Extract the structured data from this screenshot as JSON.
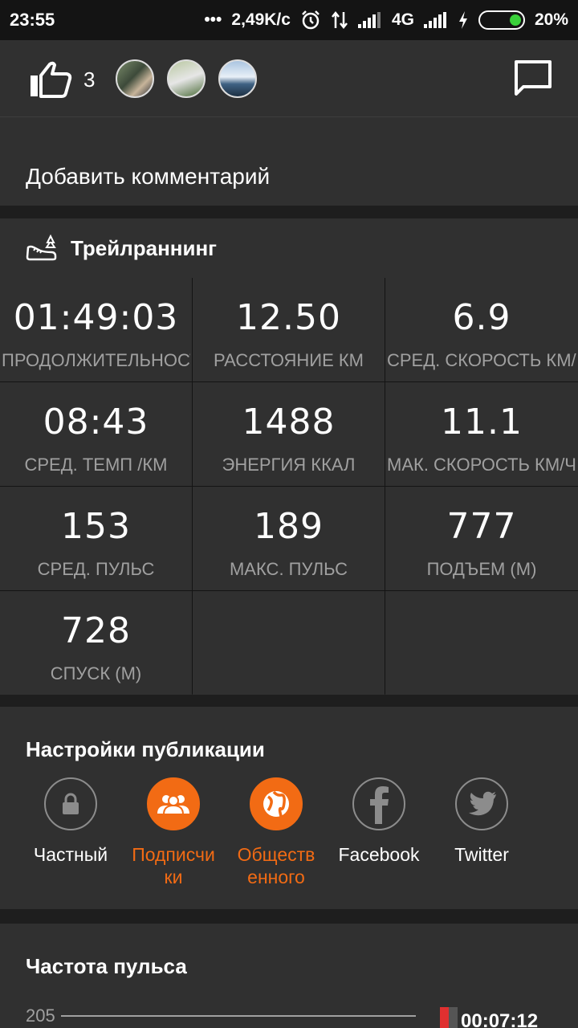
{
  "status_bar": {
    "time": "23:55",
    "dots": "•••",
    "speed": "2,49K/c",
    "network": "4G",
    "battery": "20%"
  },
  "likes": {
    "count": "3",
    "avatars": [
      "avatar-1",
      "avatar-2",
      "avatar-3"
    ]
  },
  "add_comment": "Добавить комментарий",
  "activity": {
    "title": "Трейлраннинг",
    "stats": [
      {
        "value": "01:49:03",
        "label": "ПРОДОЛЖИТЕЛЬНОСТЬ"
      },
      {
        "value": "12.50",
        "label": "РАССТОЯНИЕ КМ"
      },
      {
        "value": "6.9",
        "label": "СРЕД. СКОРОСТЬ КМ/Ч"
      },
      {
        "value": "08:43",
        "label": "СРЕД. ТЕМП /КМ"
      },
      {
        "value": "1488",
        "label": "ЭНЕРГИЯ ККАЛ"
      },
      {
        "value": "11.1",
        "label": "МАК. СКОРОСТЬ КМ/Ч"
      },
      {
        "value": "153",
        "label": "СРЕД. ПУЛЬС"
      },
      {
        "value": "189",
        "label": "МАКС. ПУЛЬС"
      },
      {
        "value": "777",
        "label": "ПОДЪЕМ (М)"
      },
      {
        "value": "728",
        "label": "СПУСК (М)"
      }
    ]
  },
  "publication": {
    "title": "Настройки публикации",
    "options": [
      {
        "line1": "Частный",
        "line2": "",
        "icon": "lock-icon",
        "active": false
      },
      {
        "line1": "Подписчи",
        "line2": "ки",
        "icon": "followers-icon",
        "active": true
      },
      {
        "line1": "Обществ",
        "line2": "енного",
        "icon": "globe-icon",
        "active": true
      },
      {
        "line1": "Facebook",
        "line2": "",
        "icon": "facebook-icon",
        "active": false
      },
      {
        "line1": "Twitter",
        "line2": "",
        "icon": "twitter-icon",
        "active": false
      }
    ]
  },
  "heart_rate": {
    "title": "Частота пульса",
    "axis_max": "205",
    "time": "00:07:12"
  },
  "colors": {
    "accent": "#f26b14",
    "panel": "#303030",
    "background": "#1e1e1e",
    "label": "#a0a0a0"
  }
}
